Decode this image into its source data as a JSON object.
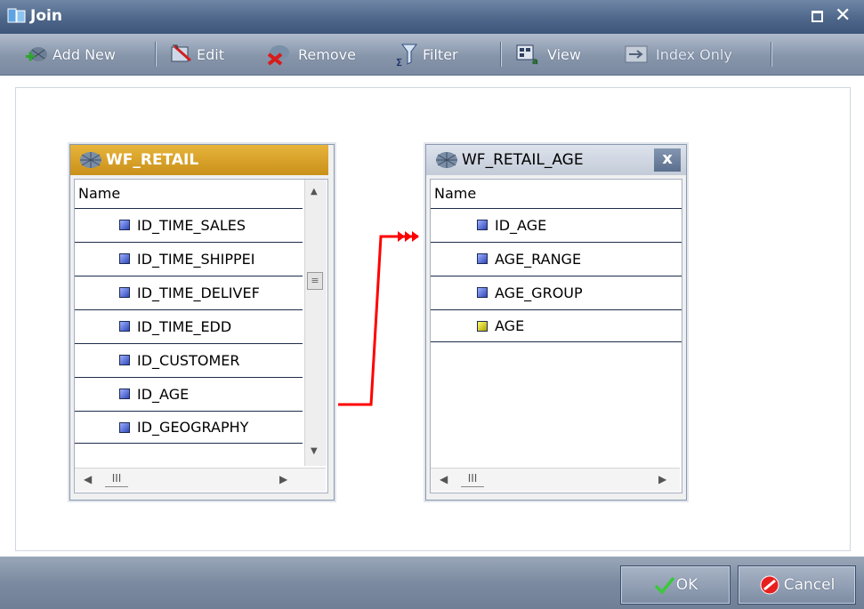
{
  "window": {
    "title": "Join"
  },
  "toolbar": {
    "add_new": "Add New",
    "edit": "Edit",
    "remove": "Remove",
    "filter": "Filter",
    "view": "View",
    "index_only": "Index Only"
  },
  "left_table": {
    "name": "WF_RETAIL",
    "column_header": "Name",
    "fields": [
      "ID_TIME_SALES",
      "ID_TIME_SHIPPEI",
      "ID_TIME_DELIVEF",
      "ID_TIME_EDD",
      "ID_CUSTOMER",
      "ID_AGE",
      "ID_GEOGRAPHY"
    ],
    "header_color": "#d9a323"
  },
  "right_table": {
    "name": "WF_RETAIL_AGE",
    "column_header": "Name",
    "close_label": "x",
    "fields": [
      "ID_AGE",
      "AGE_RANGE",
      "AGE_GROUP",
      "AGE"
    ],
    "header_color": "#c9d0da"
  },
  "join_line_color": "#ff0000",
  "footer": {
    "ok": "OK",
    "cancel": "Cancel"
  }
}
